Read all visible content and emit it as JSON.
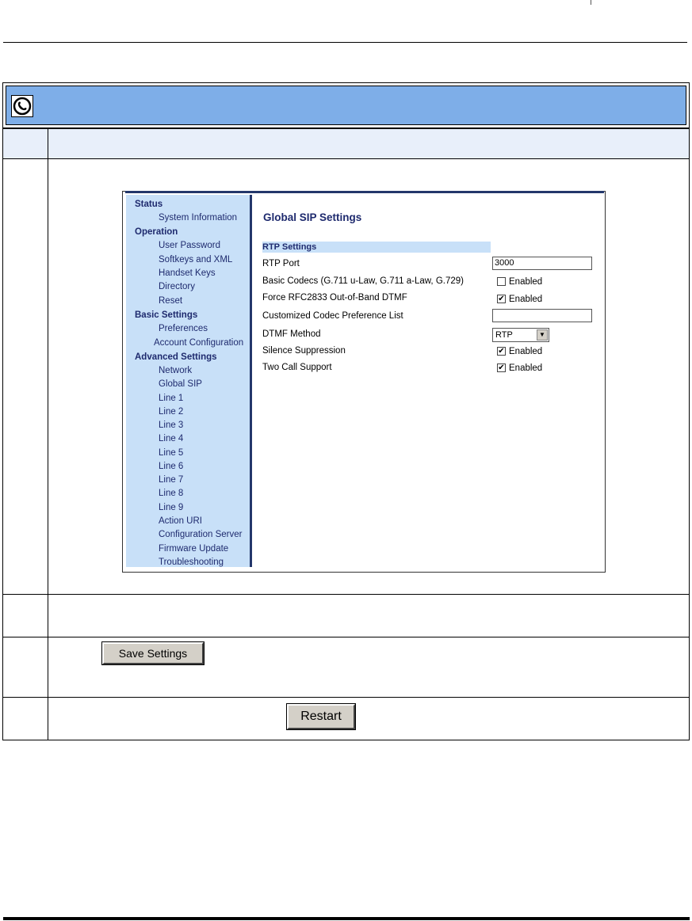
{
  "icon_name": "phone-globe-icon",
  "nav": {
    "status": "Status",
    "system_information": "System Information",
    "operation": "Operation",
    "user_password": "User Password",
    "softkeys_xml": "Softkeys and XML",
    "handset_keys": "Handset Keys",
    "directory": "Directory",
    "reset": "Reset",
    "basic_settings": "Basic Settings",
    "preferences": "Preferences",
    "account_configuration": "Account Configuration",
    "advanced_settings": "Advanced Settings",
    "network": "Network",
    "global_sip": "Global SIP",
    "lines": [
      "Line 1",
      "Line 2",
      "Line 3",
      "Line 4",
      "Line 5",
      "Line 6",
      "Line 7",
      "Line 8",
      "Line 9"
    ],
    "action_uri": "Action URI",
    "configuration_server": "Configuration Server",
    "firmware_update": "Firmware Update",
    "troubleshooting": "Troubleshooting"
  },
  "main": {
    "title": "Global SIP Settings",
    "section": "RTP Settings",
    "rtp_port_label": "RTP Port",
    "rtp_port_value": "3000",
    "basic_codecs_label": "Basic Codecs (G.711 u-Law, G.711 a-Law, G.729)",
    "force_rfc_label": "Force RFC2833 Out-of-Band DTMF",
    "custom_codec_label": "Customized Codec Preference List",
    "custom_codec_value": "",
    "dtmf_method_label": "DTMF Method",
    "dtmf_method_value": "RTP",
    "silence_label": "Silence Suppression",
    "two_call_label": "Two Call Support",
    "enabled_label": "Enabled",
    "basic_codecs_checked": false,
    "force_rfc_checked": true,
    "silence_checked": true,
    "two_call_checked": true
  },
  "buttons": {
    "save": "Save Settings",
    "restart": "Restart"
  }
}
